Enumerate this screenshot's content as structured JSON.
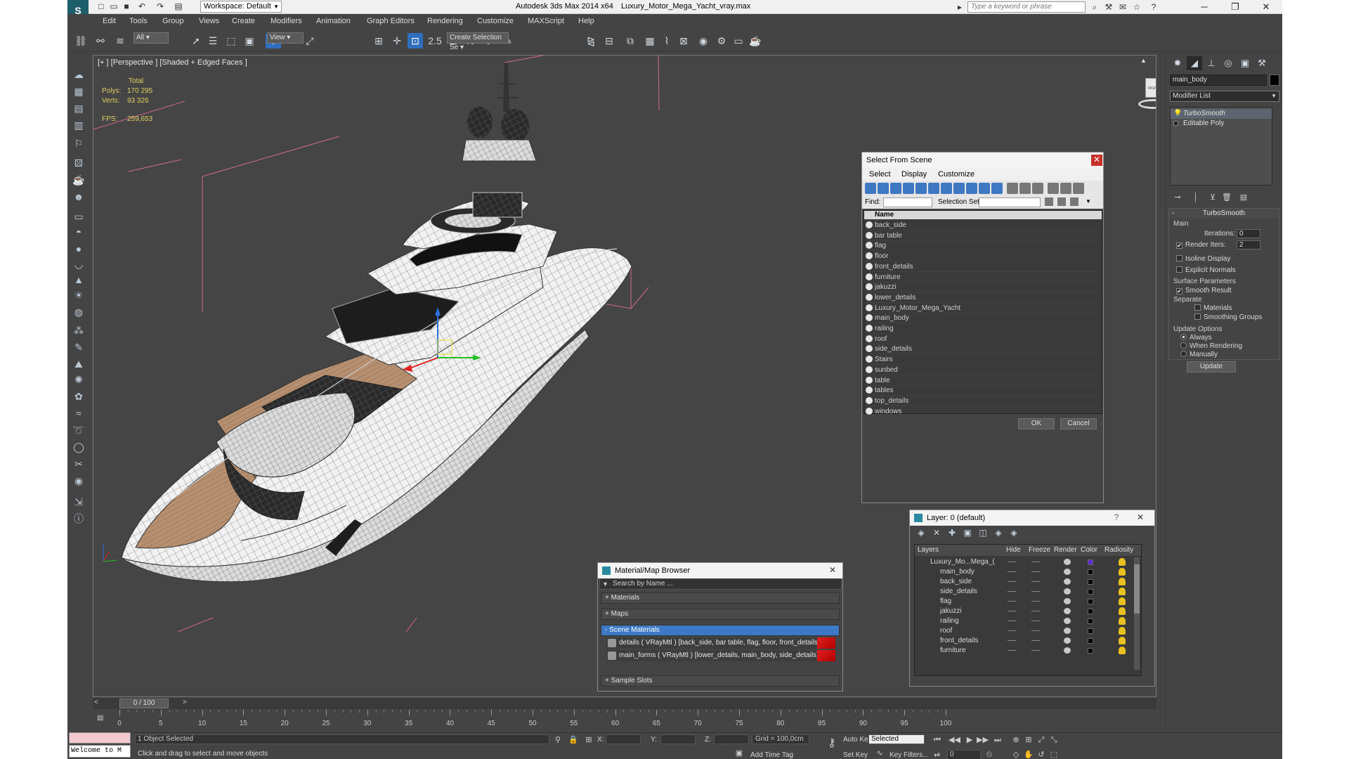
{
  "window": {
    "title": "Autodesk 3ds Max  2014 x64",
    "file": "Luxury_Motor_Mega_Yacht_vray.max",
    "workspace": "Workspace: Default",
    "search_placeholder": "Type a keyword or phrase"
  },
  "menu": [
    "Edit",
    "Tools",
    "Group",
    "Views",
    "Create",
    "Modifiers",
    "Animation",
    "Graph Editors",
    "Rendering",
    "Customize",
    "MAXScript",
    "Help"
  ],
  "toolbar": {
    "filter": "All",
    "ref_coord": "View",
    "selection_set": "Create Selection Se"
  },
  "viewport": {
    "label": "[+ ] [Perspective ] [Shaded + Edged Faces ]",
    "stats": {
      "header": "Total",
      "polys_label": "Polys:",
      "polys": "170 295",
      "verts_label": "Verts:",
      "verts": "93 326",
      "fps_label": "FPS:",
      "fps": "259,653"
    },
    "viewcube_label": "RIGHT"
  },
  "command_panel": {
    "object_name": "main_body",
    "modifier_list": "Modifier List",
    "stack": [
      "TurboSmooth",
      "Editable Poly"
    ],
    "rollout_title": "TurboSmooth",
    "main_group": "Main",
    "iterations_label": "Iterations:",
    "iterations": "0",
    "render_iters_label": "Render Iters:",
    "render_iters": "2",
    "isoline": "Isoline Display",
    "explicit_normals": "Explicit Normals",
    "surface_params": "Surface Parameters",
    "smooth_result": "Smooth Result",
    "separate": "Separate",
    "materials": "Materials",
    "smoothing_groups": "Smoothing Groups",
    "update_options": "Update Options",
    "always": "Always",
    "when_rendering": "When Rendering",
    "manually": "Manually",
    "update_button": "Update"
  },
  "select_from_scene": {
    "title": "Select From Scene",
    "menus": [
      "Select",
      "Display",
      "Customize"
    ],
    "find_label": "Find:",
    "selection_set_label": "Selection Set:",
    "column": "Name",
    "items": [
      "back_side",
      "bar table",
      "flag",
      "floor",
      "front_details",
      "furniture",
      "jakuzzi",
      "lower_details",
      "Luxury_Motor_Mega_Yacht",
      "main_body",
      "railing",
      "roof",
      "side_details",
      "Stairs",
      "sunbed",
      "table",
      "tables",
      "top_details",
      "windows"
    ],
    "ok": "OK",
    "cancel": "Cancel"
  },
  "material_browser": {
    "title": "Material/Map Browser",
    "search": "Search by Name ...",
    "sections": [
      "+ Materials",
      "+ Maps",
      "- Scene Materials",
      "+ Sample Slots"
    ],
    "scene_materials": [
      "details  ( VRayMtl ) [back_side, bar table, flag, floor, front_details, furniture, jak...",
      "main_forms  ( VRayMtl ) [lower_details, main_body, side_details]"
    ]
  },
  "layer_manager": {
    "title": "Layer: 0 (default)",
    "help": "?",
    "columns": [
      "Layers",
      "Hide",
      "Freeze",
      "Render",
      "Color",
      "Radiosity"
    ],
    "rows": [
      "Luxury_Mo...Mega_(",
      "main_body",
      "back_side",
      "side_details",
      "flag",
      "jakuzzi",
      "railing",
      "roof",
      "front_details",
      "furniture"
    ],
    "parent_color": "#5a2ad0"
  },
  "timeline": {
    "slider": "0 / 100",
    "ticks": [
      "0",
      "5",
      "10",
      "15",
      "20",
      "25",
      "30",
      "35",
      "40",
      "45",
      "50",
      "55",
      "60",
      "65",
      "70",
      "75",
      "80",
      "85",
      "90",
      "95",
      "100"
    ]
  },
  "status": {
    "welcome": "Welcome to M",
    "selected": "1 Object Selected",
    "prompt": "Click and drag to select and move objects",
    "x_label": "X:",
    "y_label": "Y:",
    "z_label": "Z:",
    "grid": "Grid = 100,0cm",
    "auto_key": "Auto Key",
    "set_key": "Set Key",
    "key_mode": "Selected",
    "key_filters": "Key Filters...",
    "add_time_tag": "Add Time Tag",
    "frame": "0"
  }
}
